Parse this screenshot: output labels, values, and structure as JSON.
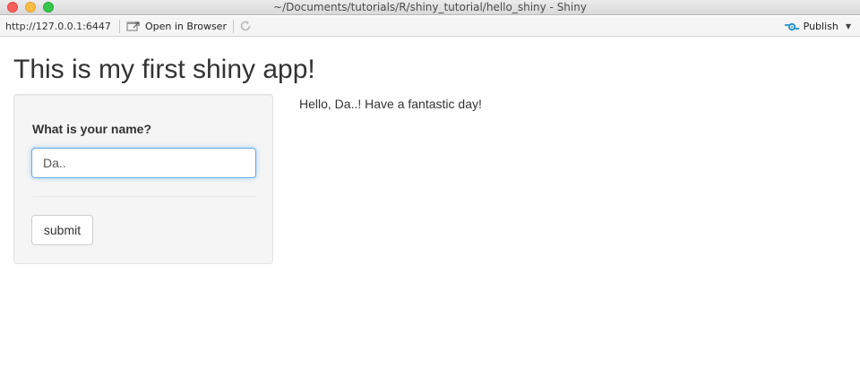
{
  "window": {
    "title": "~/Documents/tutorials/R/shiny_tutorial/hello_shiny - Shiny"
  },
  "toolbar": {
    "url": "http://127.0.0.1:6447",
    "open_in_browser_label": "Open in Browser",
    "publish_label": "Publish",
    "icons": [
      "open-browser-icon",
      "refresh-icon",
      "publish-icon",
      "chevron-down-icon"
    ]
  },
  "app": {
    "title": "This is my first shiny app!",
    "input_label": "What is your name?",
    "input_value": "Da..",
    "submit_label": "submit",
    "output_text": "Hello, Da..! Have a fantastic day!"
  },
  "colors": {
    "input_focus_border": "#66afe9",
    "panel_background": "#f5f5f5",
    "publish_accent": "#1a8fcc"
  }
}
